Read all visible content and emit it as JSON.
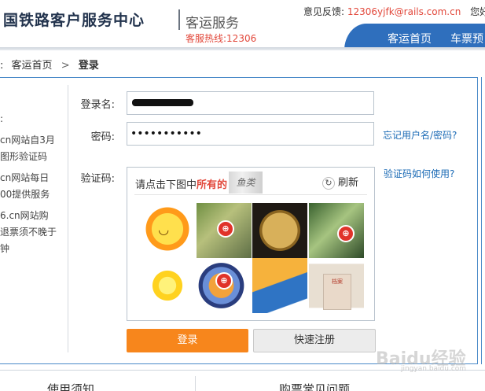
{
  "header": {
    "logo_text": "国铁路客户服务中心",
    "service": "客运服务",
    "hotline": "客服热线:12306",
    "feedback_label": "意见反馈:",
    "feedback_email": "12306yjfk@rails.com.cn",
    "greeting": "您好,",
    "nav": [
      "客运首页",
      "车票预"
    ]
  },
  "breadcrumb": {
    "home": "客运首页",
    "separator": ">",
    "current": "登录"
  },
  "notice": {
    "marker": ":",
    "lines": [
      "cn网站自3月",
      "图形验证码",
      "cn网站每日",
      "00提供服务",
      "6.cn网站购",
      "退票须不晚于",
      "钟"
    ]
  },
  "form": {
    "username_label": "登录名:",
    "password_label": "密码:",
    "password_mask": "•••••••••••",
    "captcha_label": "验证码:",
    "forgot_link": "忘记用户名/密码?",
    "captcha_help_link": "验证码如何使用?"
  },
  "captcha": {
    "prompt_prefix": "请点击下图中",
    "prompt_target": "所有的",
    "refresh_label": "刷新",
    "refresh_icon": "refresh-icon",
    "tiles": [
      "sun",
      "fish",
      "coin",
      "fish",
      "sun",
      "clown-fish",
      "folder",
      "paper"
    ]
  },
  "buttons": {
    "login": "登录",
    "register": "快速注册"
  },
  "bottom": {
    "tab_left": "使用须知",
    "tab_right": "购票常见问题"
  },
  "watermark": {
    "brand": "Baidu经验",
    "url": "jingyan.baidu.com"
  },
  "colors": {
    "accent_orange": "#f7861c",
    "nav_blue": "#2f6fbd",
    "alert_red": "#e2483b",
    "link_blue": "#1a6ab5"
  }
}
